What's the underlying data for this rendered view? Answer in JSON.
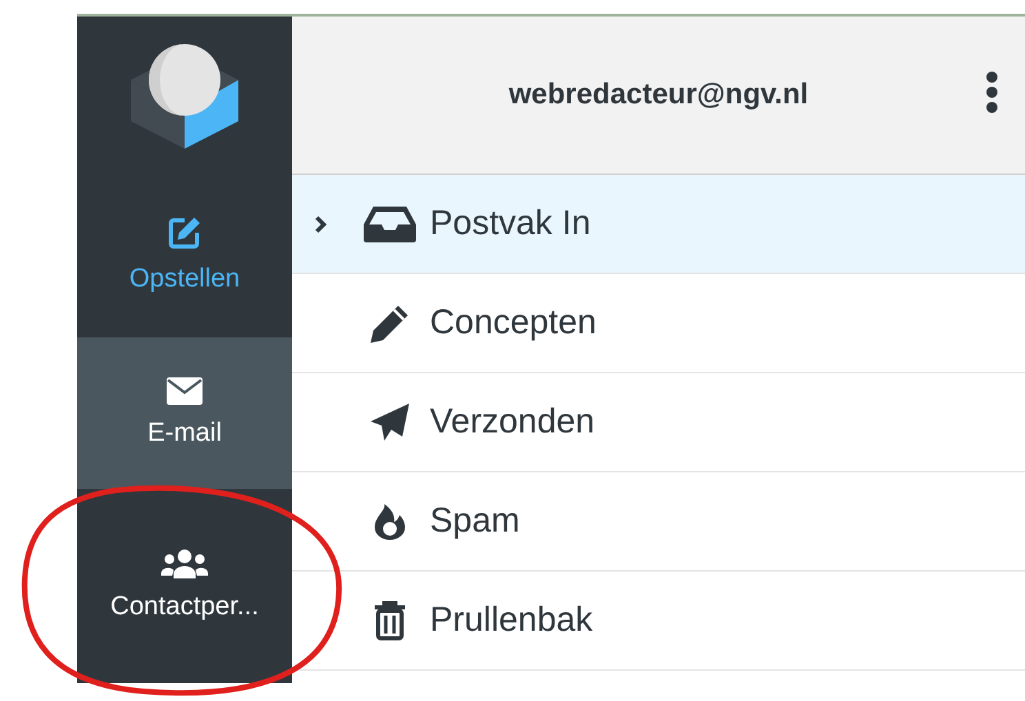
{
  "sidebar": {
    "items": [
      {
        "kind": "compose",
        "label": "Opstellen",
        "selected": false
      },
      {
        "kind": "nav",
        "label": "E-mail",
        "selected": true
      },
      {
        "kind": "nav",
        "label": "Contactper...",
        "selected": false
      }
    ]
  },
  "header": {
    "account": "webredacteur@ngv.nl"
  },
  "folders": [
    {
      "label": "Postvak In",
      "selected": true,
      "expandable": true
    },
    {
      "label": "Concepten",
      "selected": false,
      "expandable": false
    },
    {
      "label": "Verzonden",
      "selected": false,
      "expandable": false
    },
    {
      "label": "Spam",
      "selected": false,
      "expandable": false
    },
    {
      "label": "Prullenbak",
      "selected": false,
      "expandable": false
    }
  ],
  "annotation": {
    "kind": "circle"
  }
}
